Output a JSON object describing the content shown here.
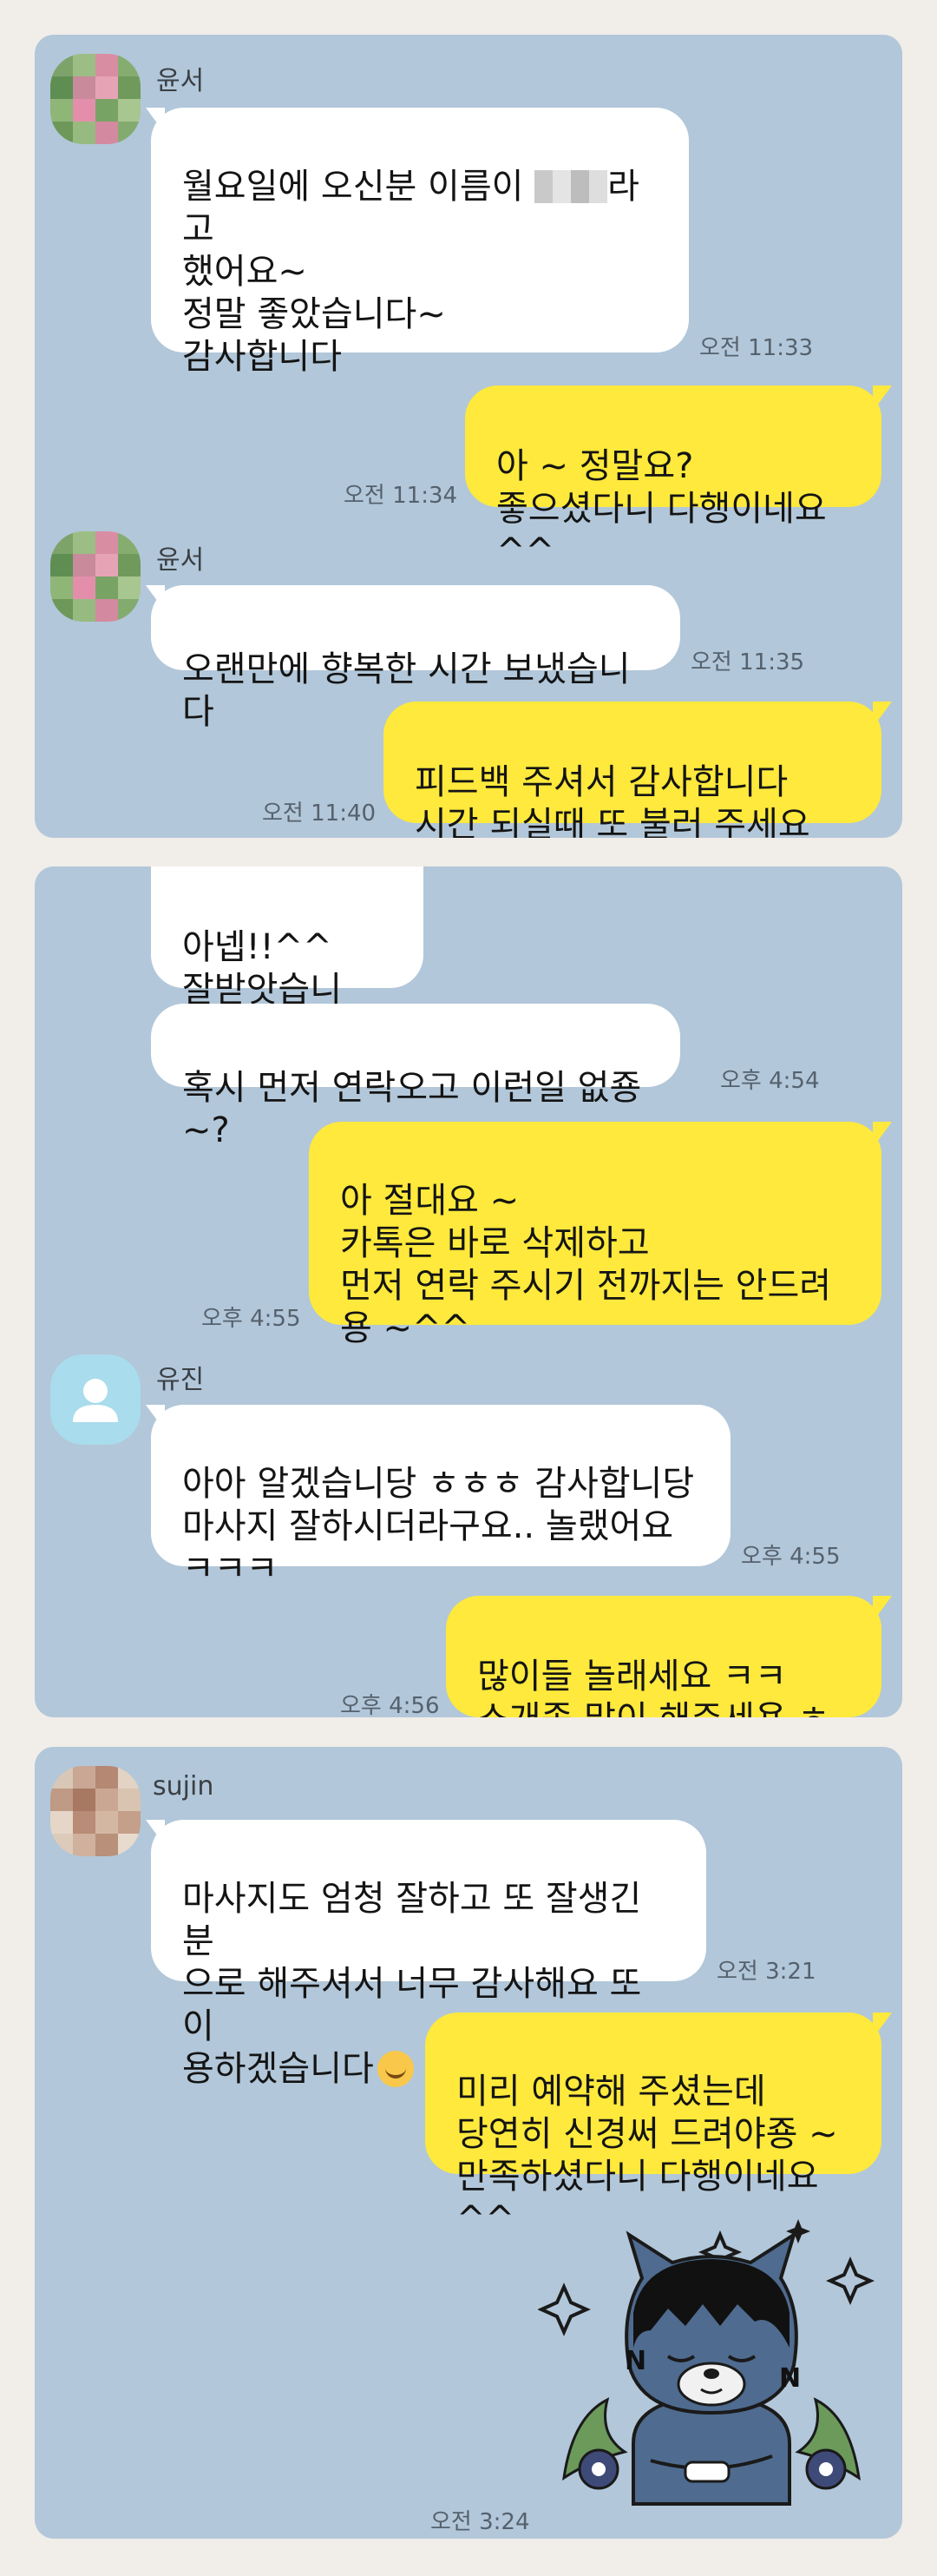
{
  "chat1": {
    "messages": [
      {
        "sender": "윤서",
        "line1_before": "월요일에 오신분 이름이 ",
        "line1_after": "라고",
        "rest": "했어요~\n정말 좋았습니다~\n감사합니다",
        "time": "오전 11:33"
      },
      {
        "text": "아 ~ 정말요?\n좋으셨다니 다행이네요 ^^",
        "time": "오전 11:34"
      },
      {
        "sender": "윤서",
        "text": "오랜만에 향복한 시간 보냈습니다",
        "time": "오전 11:35"
      },
      {
        "text": "피드백 주셔서 감사합니다\n시간 되실때 또 불러 주세요 ~^^",
        "time": "오전 11:40"
      }
    ]
  },
  "chat2": {
    "messages": [
      {
        "text": "아넵!!^^\n잘받앗습니당!!"
      },
      {
        "text": "혹시 먼저 연락오고 이런일 없죵~?",
        "time": "오후 4:54"
      },
      {
        "text": "아 절대요 ~\n카톡은 바로 삭제하고\n먼저 연락 주시기 전까지는 안드려\n용 ~^^",
        "time": "오후 4:55"
      },
      {
        "sender": "유진",
        "text": "아아 알겠습니당 ㅎㅎㅎ 감사합니당\n마사지 잘하시더라구요.. 놀랬어요\nㅋㅋㅋ",
        "time": "오후 4:55"
      },
      {
        "text": "많이들 놀래세요 ㅋㅋ\n소개좀 많이 해주세용 ㅎㅎ",
        "time": "오후 4:56"
      }
    ]
  },
  "chat3": {
    "messages": [
      {
        "sender": "sujin",
        "text": "마사지도 엄청 잘하고 또 잘생긴 분\n으로 해주셔서 너무 감사해요 또 이\n용하겠습니다",
        "time": "오전 3:21"
      },
      {
        "text": "미리 예약해 주셨는데\n당연히 신경써 드려야죵 ~\n만족하셨다니 다행이네요 ^^"
      },
      {
        "time": "오전 3:24"
      }
    ]
  },
  "colors": {
    "chat_bg": "#b2c7d9",
    "incoming_bubble": "#ffffff",
    "outgoing_bubble": "#fee93c",
    "page_bg": "#f1ede9"
  }
}
